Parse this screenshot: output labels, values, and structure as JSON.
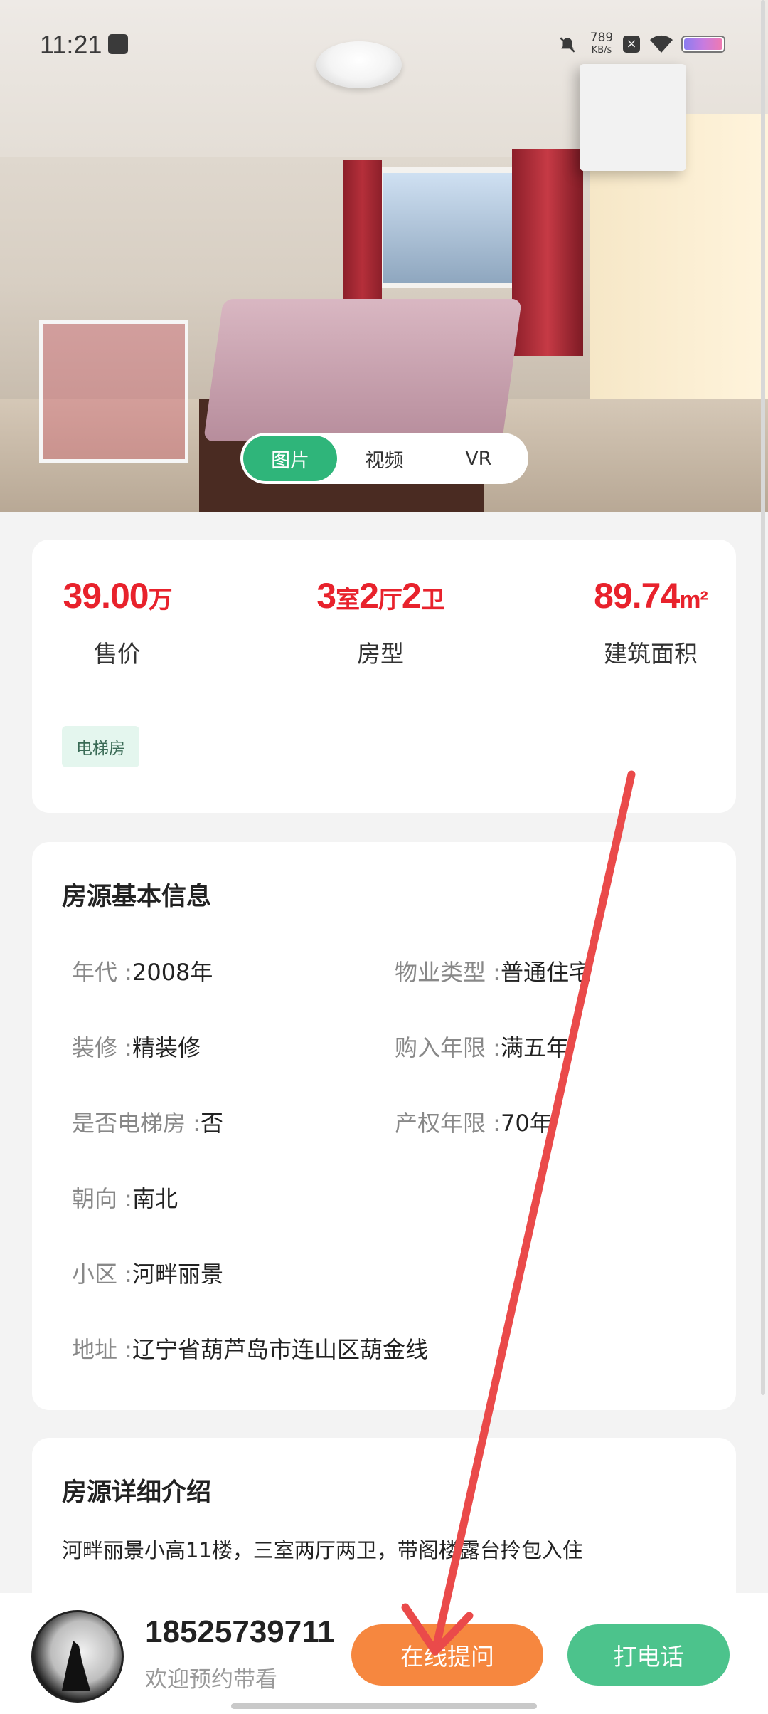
{
  "status_bar": {
    "time": "11:21",
    "net_speed_value": "789",
    "net_speed_unit": "KB/s"
  },
  "media_tabs": [
    {
      "label": "图片",
      "active": true
    },
    {
      "label": "视频",
      "active": false
    },
    {
      "label": "VR",
      "active": false
    }
  ],
  "summary": {
    "price_value": "39.00",
    "price_unit": "万",
    "price_label": "售价",
    "layout_rooms": "3",
    "layout_rooms_unit": "室",
    "layout_halls": "2",
    "layout_halls_unit": "厅",
    "layout_baths": "2",
    "layout_baths_unit": "卫",
    "layout_label": "房型",
    "area_value": "89.74",
    "area_unit": "m²",
    "area_label": "建筑面积",
    "tag": "电梯房"
  },
  "basic_info": {
    "title": "房源基本信息",
    "items": [
      {
        "key": "年代 :",
        "value": "2008年"
      },
      {
        "key": "物业类型 :",
        "value": "普通住宅"
      },
      {
        "key": "装修 :",
        "value": "精装修"
      },
      {
        "key": "购入年限 :",
        "value": "满五年"
      },
      {
        "key": "是否电梯房 :",
        "value": "否"
      },
      {
        "key": "产权年限 :",
        "value": "70年"
      },
      {
        "key": "朝向 :",
        "value": "南北"
      },
      {
        "key": "小区 :",
        "value": "河畔丽景"
      },
      {
        "key": "地址 :",
        "value": "辽宁省葫芦岛市连山区葫金线"
      }
    ]
  },
  "detail": {
    "title": "房源详细介绍",
    "text": "河畔丽景小高11楼，三室两厅两卫，带阁楼露台拎包入住"
  },
  "agent": {
    "phone": "18525739711",
    "subtitle": "欢迎预约带看"
  },
  "actions": {
    "ask_online": "在线提问",
    "call": "打电话"
  },
  "colors": {
    "accent_green": "#2fb57a",
    "price_red": "#e8222c",
    "ask_orange": "#f6873f",
    "call_green": "#4cc38c"
  }
}
